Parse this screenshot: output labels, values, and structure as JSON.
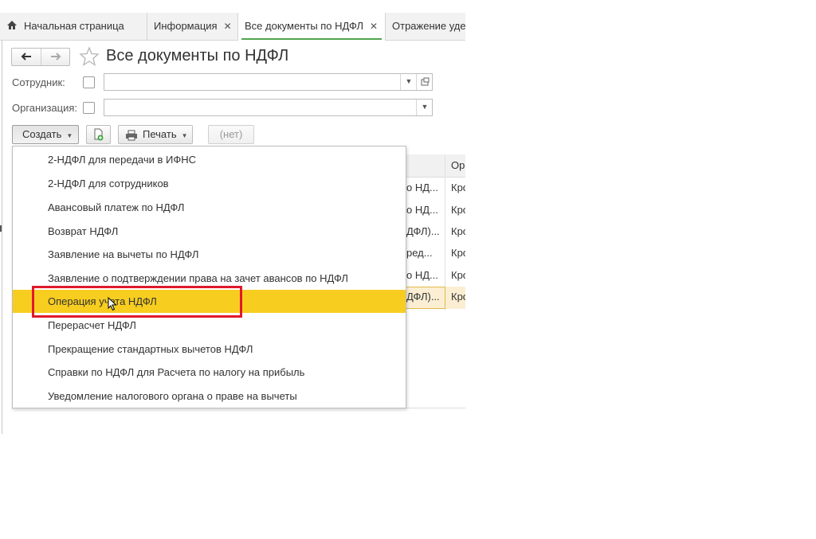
{
  "tabs": [
    {
      "label": "Начальная страница",
      "home": true
    },
    {
      "label": "Информация",
      "closable": true
    },
    {
      "label": "Все документы по НДФЛ",
      "closable": true,
      "active": true
    },
    {
      "label": "Отражение уде"
    }
  ],
  "close_glyph": "✕",
  "header": {
    "title": "Все документы по НДФЛ"
  },
  "filters": {
    "employee_label": "Сотрудник:",
    "organization_label": "Организация:"
  },
  "toolbar": {
    "create_label": "Создать",
    "print_label": "Печать",
    "none_label": "(нет)"
  },
  "grid_behind": {
    "header_col2": "Ор",
    "rows": [
      {
        "c1": "о НД...",
        "c2": "Кро"
      },
      {
        "c1": "о НД...",
        "c2": "Кро"
      },
      {
        "c1": "ДФЛ)...",
        "c2": "Кро"
      },
      {
        "c1": "ред...",
        "c2": "Кро"
      },
      {
        "c1": "о НД...",
        "c2": "Кро"
      },
      {
        "c1": "ДФЛ)...",
        "c2": "Кро"
      }
    ]
  },
  "create_menu": {
    "items": [
      "2-НДФЛ для передачи в ИФНС",
      "2-НДФЛ для сотрудников",
      "Авансовый платеж по НДФЛ",
      "Возврат НДФЛ",
      "Заявление на вычеты по НДФЛ",
      "Заявление о подтверждении права на зачет авансов по НДФЛ",
      "Операция учета НДФЛ",
      "Перерасчет НДФЛ",
      "Прекращение стандартных вычетов НДФЛ",
      "Справки по НДФЛ для Расчета по налогу на прибыль",
      "Уведомление налогового органа о праве на вычеты"
    ],
    "highlighted_index": 6
  },
  "colors": {
    "highlight": "#f7cd1f",
    "annotation": "#e0192a",
    "active_tab_underline": "#4fa64f"
  }
}
